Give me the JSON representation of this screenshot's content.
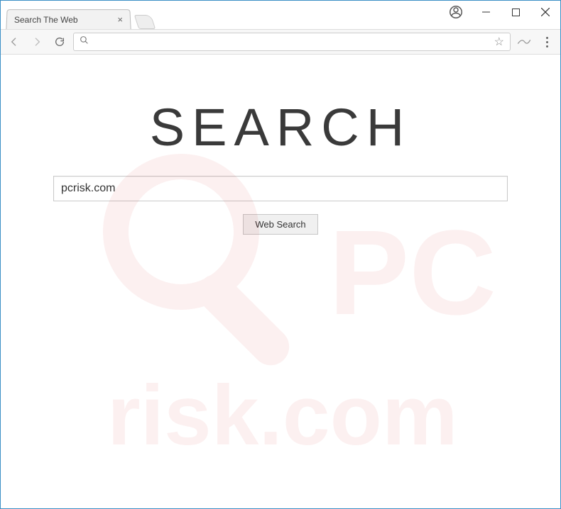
{
  "window": {
    "tab_title": "Search The Web"
  },
  "toolbar": {
    "url": ""
  },
  "page": {
    "logo": "SEARCH",
    "search_value": "pcrisk.com",
    "search_button": "Web Search"
  },
  "watermark": {
    "text1": "PC",
    "text2": "risk.com"
  }
}
